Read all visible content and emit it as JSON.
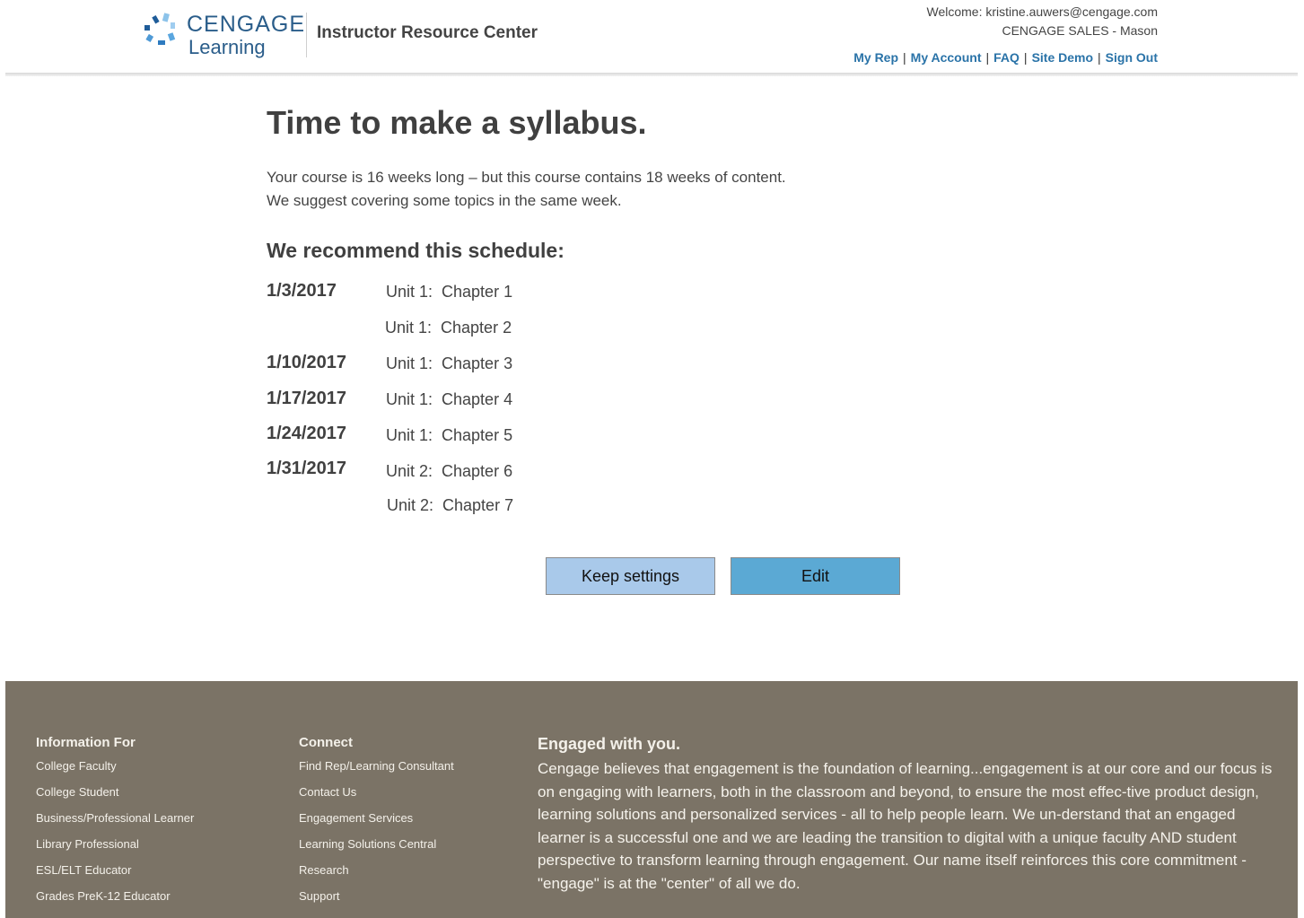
{
  "header": {
    "logo_line1": "CENGAGE",
    "logo_line2": "Learning",
    "site_title": "Instructor Resource Center",
    "welcome": "Welcome: kristine.auwers@cengage.com",
    "org": "CENGAGE SALES - Mason",
    "nav": [
      "My Rep",
      "My Account",
      "FAQ",
      "Site Demo",
      "Sign Out"
    ]
  },
  "main": {
    "title": "Time to make a syllabus.",
    "intro_line1": "Your course is 16 weeks long – but this course contains 18 weeks of content.",
    "intro_line2": "We suggest covering some topics in the same week.",
    "recommend_heading": "We recommend this schedule:",
    "schedule": [
      {
        "date": "1/3/2017",
        "item": "Unit 1:  Chapter 1"
      },
      {
        "date": "",
        "item": "Unit 1:  Chapter 2"
      },
      {
        "date": "1/10/2017",
        "item": "Unit 1:  Chapter 3"
      },
      {
        "date": "1/17/2017",
        "item": "Unit 1:  Chapter 4"
      },
      {
        "date": "1/24/2017",
        "item": "Unit 1:  Chapter 5"
      },
      {
        "date": "1/31/2017",
        "item": "Unit 2:  Chapter 6"
      },
      {
        "date": "",
        "item": "Unit 2:  Chapter 7"
      }
    ],
    "keep_label": "Keep settings",
    "edit_label": "Edit"
  },
  "footer": {
    "info_heading": "Information For",
    "info_links": [
      "College Faculty",
      "College Student",
      "Business/Professional Learner",
      "Library Professional",
      "ESL/ELT Educator",
      "Grades PreK-12 Educator"
    ],
    "connect_heading": "Connect",
    "connect_links": [
      "Find Rep/Learning Consultant",
      "Contact Us",
      "Engagement Services",
      "Learning Solutions Central",
      "Research",
      "Support"
    ],
    "engaged_heading": "Engaged with you.",
    "engaged_text": "Cengage believes that engagement is the foundation of learning...engagement is at our core and our focus is on engaging with learners, both in the classroom and beyond, to ensure the most effec-tive product design, learning solutions and personalized services - all to help people learn. We un-derstand that an engaged learner is a successful one and we are leading the transition to digital with a unique faculty AND student perspective to transform learning through engagement. Our name itself reinforces this core commitment - \"engage\" is at the \"center\" of all we do."
  }
}
